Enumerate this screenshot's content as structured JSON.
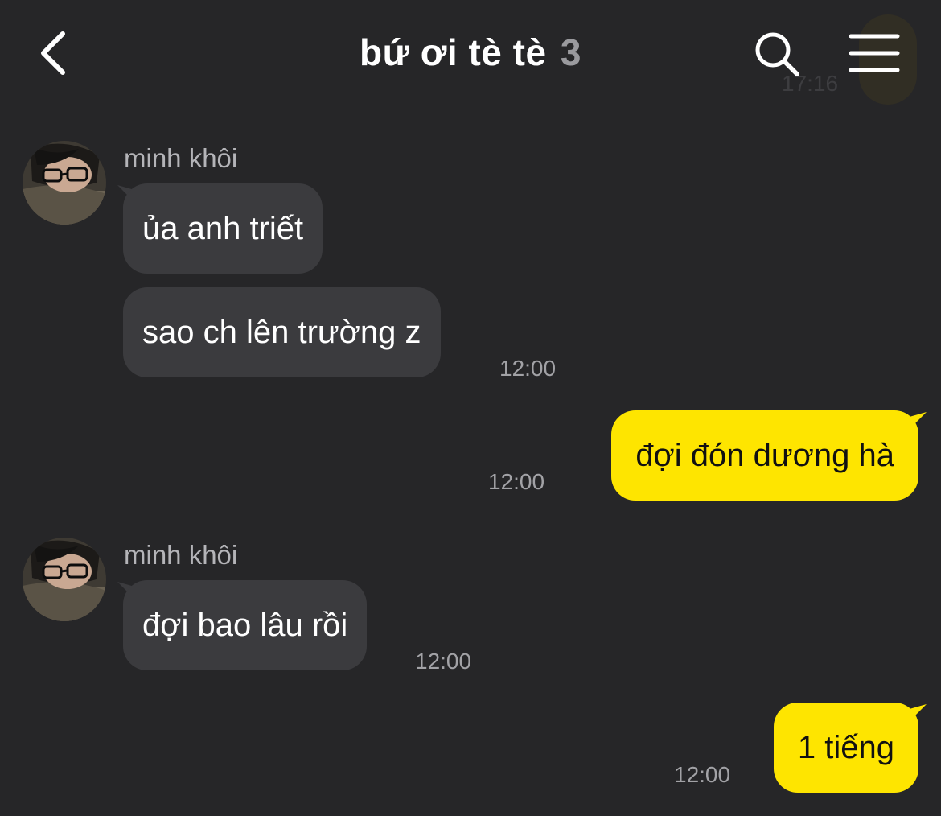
{
  "header": {
    "back_icon": "chevron-left-icon",
    "title": "bứ ơi tè tè",
    "member_count": "3",
    "search_icon": "search-icon",
    "menu_icon": "hamburger-menu-icon",
    "ghost_time": "17:16"
  },
  "messages": [
    {
      "sender": "minh khôi",
      "direction": "incoming",
      "bubbles": [
        "ủa anh triết",
        "sao ch lên trường z"
      ],
      "time": "12:00"
    },
    {
      "direction": "outgoing",
      "bubbles": [
        "đợi đón dương hà"
      ],
      "time": "12:00"
    },
    {
      "sender": "minh khôi",
      "direction": "incoming",
      "bubbles": [
        "đợi bao lâu rồi"
      ],
      "time": "12:00"
    },
    {
      "direction": "outgoing",
      "bubbles": [
        "1 tiếng"
      ],
      "time": "12:00"
    }
  ],
  "colors": {
    "background": "#262628",
    "incoming_bubble": "#3b3b3e",
    "outgoing_bubble": "#fee500",
    "timestamp": "#a2a2a6",
    "sender_name": "#b4b4b8"
  }
}
